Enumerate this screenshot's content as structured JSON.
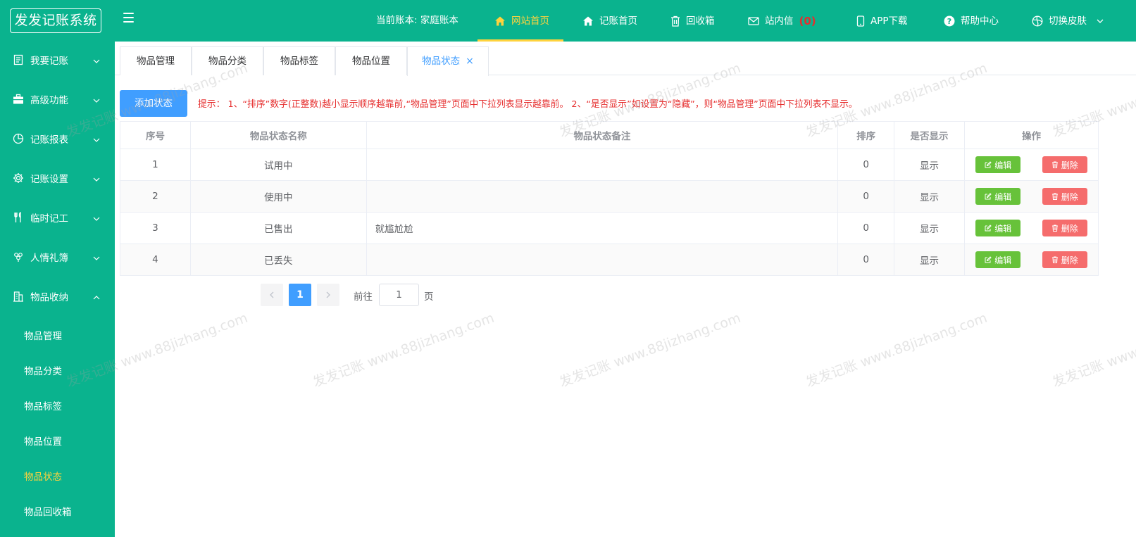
{
  "header": {
    "logo": "发发记账系统",
    "book_label": "当前账本: 家庭账本",
    "nav": [
      {
        "label": "网站首页",
        "icon": "home-icon"
      },
      {
        "label": "记账首页",
        "icon": "home-icon"
      },
      {
        "label": "回收箱",
        "icon": "trash-icon"
      },
      {
        "label": "站内信",
        "icon": "mail-icon",
        "count": "(0)"
      },
      {
        "label": "APP下载",
        "icon": "phone-icon"
      },
      {
        "label": "帮助中心",
        "icon": "help-icon"
      },
      {
        "label": "切换皮肤",
        "icon": "skin-icon"
      }
    ]
  },
  "sidebar": {
    "items": [
      {
        "label": "我要记账",
        "icon": "document-icon"
      },
      {
        "label": "高级功能",
        "icon": "briefcase-icon"
      },
      {
        "label": "记账报表",
        "icon": "pie-chart-icon"
      },
      {
        "label": "记账设置",
        "icon": "gear-icon"
      },
      {
        "label": "临时记工",
        "icon": "fork-knife-icon"
      },
      {
        "label": "人情礼簿",
        "icon": "grape-icon"
      },
      {
        "label": "物品收纳",
        "icon": "building-icon"
      }
    ],
    "subitems": [
      "物品管理",
      "物品分类",
      "物品标签",
      "物品位置",
      "物品状态",
      "物品回收箱"
    ]
  },
  "tabs": [
    "物品管理",
    "物品分类",
    "物品标签",
    "物品位置",
    "物品状态"
  ],
  "toolbar": {
    "add_label": "添加状态",
    "tip": "提示： 1、“排序”数字(正整数)越小显示顺序越靠前,“物品管理”页面中下拉列表显示越靠前。 2、“是否显示”如设置为“隐藏”，则“物品管理”页面中下拉列表不显示。"
  },
  "table": {
    "columns": [
      "序号",
      "物品状态名称",
      "物品状态备注",
      "排序",
      "是否显示",
      "操作"
    ],
    "rows": [
      {
        "index": "1",
        "name": "试用中",
        "note": "",
        "sort": "0",
        "visible": "显示"
      },
      {
        "index": "2",
        "name": "使用中",
        "note": "",
        "sort": "0",
        "visible": "显示"
      },
      {
        "index": "3",
        "name": "已售出",
        "note": "就尴尬尬",
        "sort": "0",
        "visible": "显示"
      },
      {
        "index": "4",
        "name": "已丢失",
        "note": "",
        "sort": "0",
        "visible": "显示"
      }
    ],
    "edit_label": "编辑",
    "delete_label": "删除"
  },
  "pagination": {
    "current": "1",
    "goto_label": "前往",
    "goto_value": "1",
    "page_unit": "页"
  },
  "watermark": "发发记账 www.88jizhang.com",
  "colors": {
    "primary": "#0ab38e",
    "accent": "#ffd33d",
    "blue": "#409eff",
    "green": "#67c23a",
    "red": "#f56c6c"
  }
}
